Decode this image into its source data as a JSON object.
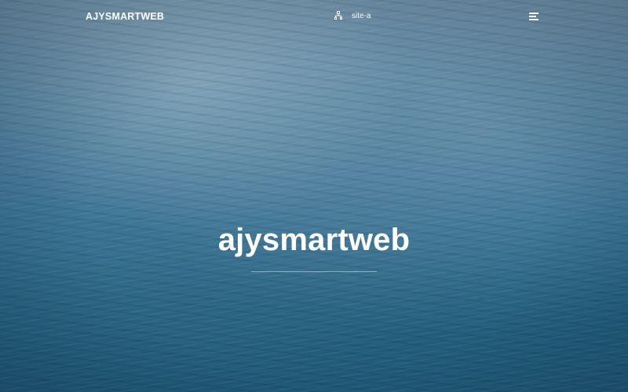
{
  "header": {
    "logo_text": "AJYSMARTWEB",
    "site_switch": {
      "icon": "sitemap-icon",
      "label": "site-a"
    },
    "menu_icon": "hamburger-icon"
  },
  "hero": {
    "title": "ajysmartweb"
  }
}
